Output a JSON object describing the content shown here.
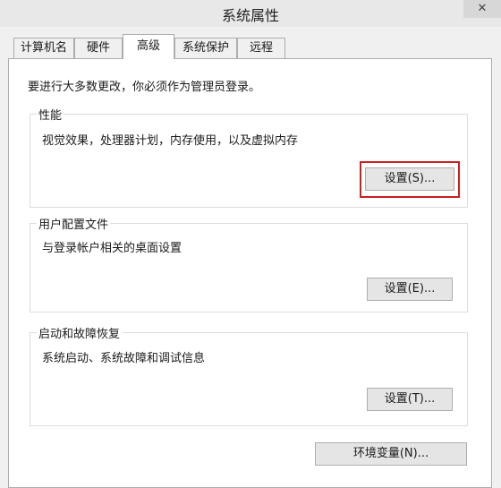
{
  "window": {
    "title": "系统属性",
    "close_label": "✕"
  },
  "tabs": [
    {
      "label": "计算机名"
    },
    {
      "label": "硬件"
    },
    {
      "label": "高级"
    },
    {
      "label": "系统保护"
    },
    {
      "label": "远程"
    }
  ],
  "active_tab": "高级",
  "notice": "要进行大多数更改，你必须作为管理员登录。",
  "performance": {
    "title": "性能",
    "description": "视觉效果，处理器计划，内存使用，以及虚拟内存",
    "button": "设置(S)..."
  },
  "user_profiles": {
    "title": "用户配置文件",
    "description": "与登录帐户相关的桌面设置",
    "button": "设置(E)..."
  },
  "startup_recovery": {
    "title": "启动和故障恢复",
    "description": "系统启动、系统故障和调试信息",
    "button": "设置(T)..."
  },
  "env_button": "环境变量(N)...",
  "colors": {
    "highlight": "#cc1f1f"
  }
}
